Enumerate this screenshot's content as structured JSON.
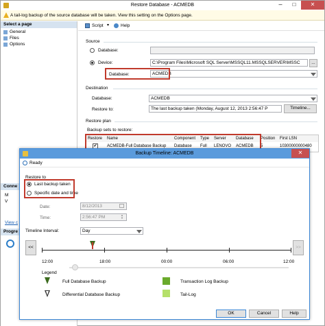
{
  "main_window": {
    "title": "Restore Database - ACMEDB",
    "warning": "A tail-log backup of the source database will be taken. View this setting on the Options page.",
    "sidebar_header": "Select a page",
    "pages": [
      "General",
      "Files",
      "Options"
    ],
    "connection_label": "Conne",
    "connection_sub": "M",
    "connection_sub2": "V",
    "view_link": "View c",
    "progress_label": "Progre",
    "toolbar": {
      "script": "Script",
      "help": "Help"
    },
    "source": {
      "heading": "Source",
      "database_radio": "Database:",
      "device_radio": "Device:",
      "device_path": "C:\\Program Files\\Microsoft SQL Server\\MSSQL11.MSSQLSERVER\\MSSC",
      "database_label": "Database:",
      "database_value": "ACMEDB",
      "browse": "..."
    },
    "destination": {
      "heading": "Destination",
      "database_label": "Database:",
      "database_value": "ACMEDB",
      "restore_to_label": "Restore to:",
      "restore_to_value": "The last backup taken (Monday, August 12, 2013 2:56:47 P",
      "timeline_button": "Timeline..."
    },
    "restore_plan": {
      "heading": "Restore plan",
      "sets_label": "Backup sets to restore:",
      "columns": [
        "Restore",
        "Name",
        "Component",
        "Type",
        "Server",
        "Database",
        "Position",
        "First LSN"
      ],
      "rows": [
        {
          "restore": "✔",
          "name": "ACMEDB-Full Database Backup",
          "component": "Database",
          "type": "Full",
          "server": "LENOVO",
          "database": "ACMEDB",
          "position": "5",
          "first_lsn": "10300000000480"
        }
      ]
    }
  },
  "timeline_dialog": {
    "title": "Backup Timeline: ACMEDB",
    "status": "Ready",
    "restore_to_heading": "Restore to",
    "option_last": "Last backup taken",
    "option_specific": "Specific date and time",
    "date_label": "Date:",
    "date_value": "8/12/2013",
    "time_label": "Time:",
    "time_value": "2:56:47 PM",
    "interval_label": "Timeline Interval:",
    "interval_value": "Day",
    "nav_prev": "<<",
    "nav_next": ">>",
    "time_ticks": [
      "12:00",
      "18:00",
      "00:00",
      "06:00",
      "12:00"
    ],
    "legend_heading": "Legend",
    "legend": {
      "full": "Full Database Backup",
      "differential": "Differential Database Backup",
      "transaction": "Transaction Log Backup",
      "tail": "Tail-Log"
    },
    "colors": {
      "full": "#3c6b1e",
      "transaction": "#6aaa2c",
      "tail": "#b5e06a"
    },
    "ok": "OK",
    "cancel": "Cancel",
    "help": "Help"
  }
}
